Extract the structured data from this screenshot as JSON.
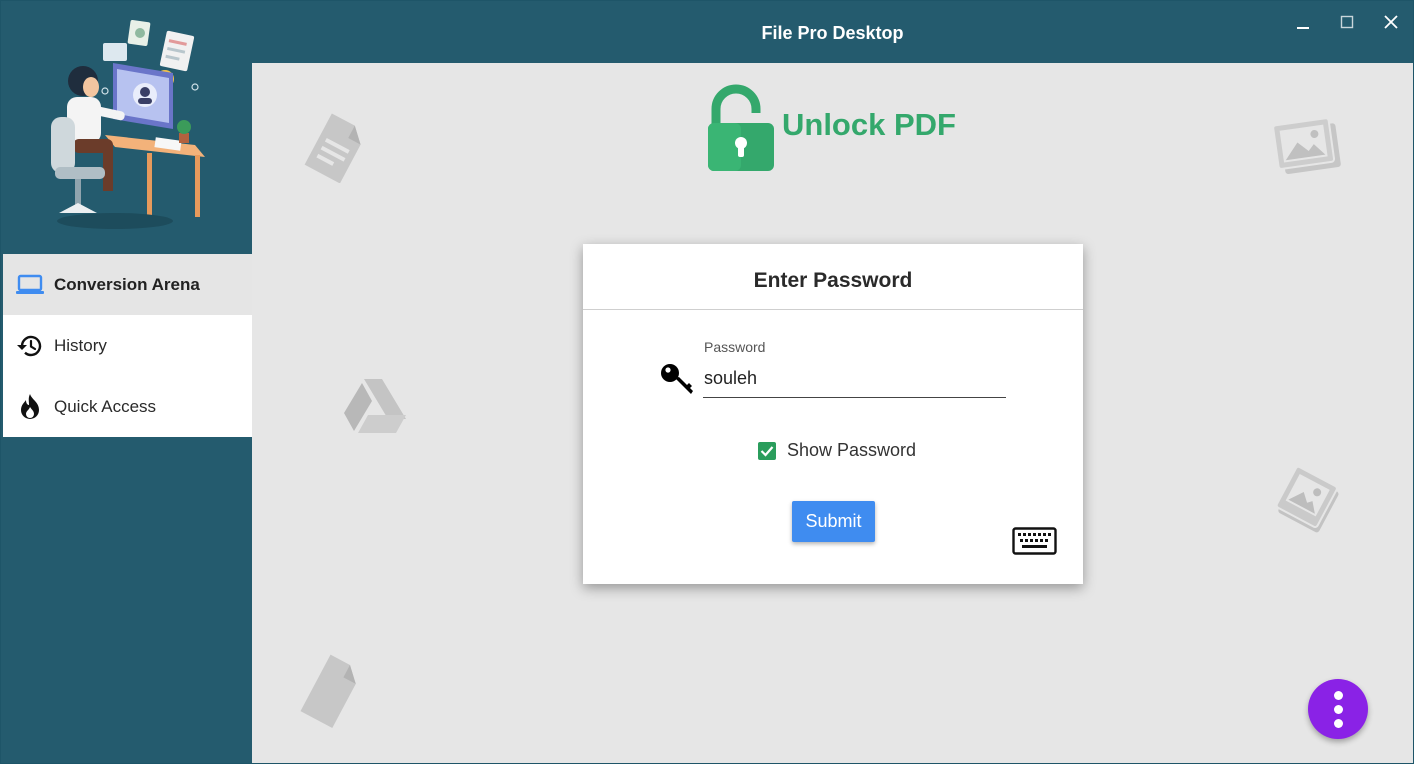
{
  "window": {
    "title": "File Pro Desktop",
    "controls": [
      "minimize",
      "maximize",
      "close"
    ]
  },
  "sidebar": {
    "items": [
      {
        "label": "Conversion Arena",
        "icon": "laptop-icon",
        "active": true
      },
      {
        "label": "History",
        "icon": "history-icon",
        "active": false
      },
      {
        "label": "Quick Access",
        "icon": "flame-icon",
        "active": false
      }
    ]
  },
  "main": {
    "heading": "Unlock PDF",
    "dialog": {
      "title": "Enter Password",
      "password_label": "Password",
      "password_value": "souleh",
      "show_password_label": "Show Password",
      "show_password_checked": true,
      "submit_label": "Submit"
    }
  },
  "colors": {
    "titlebar": "#245b6e",
    "accent_green": "#34a86c",
    "submit_blue": "#3f8cf0",
    "fab_purple": "#8a22e6"
  }
}
